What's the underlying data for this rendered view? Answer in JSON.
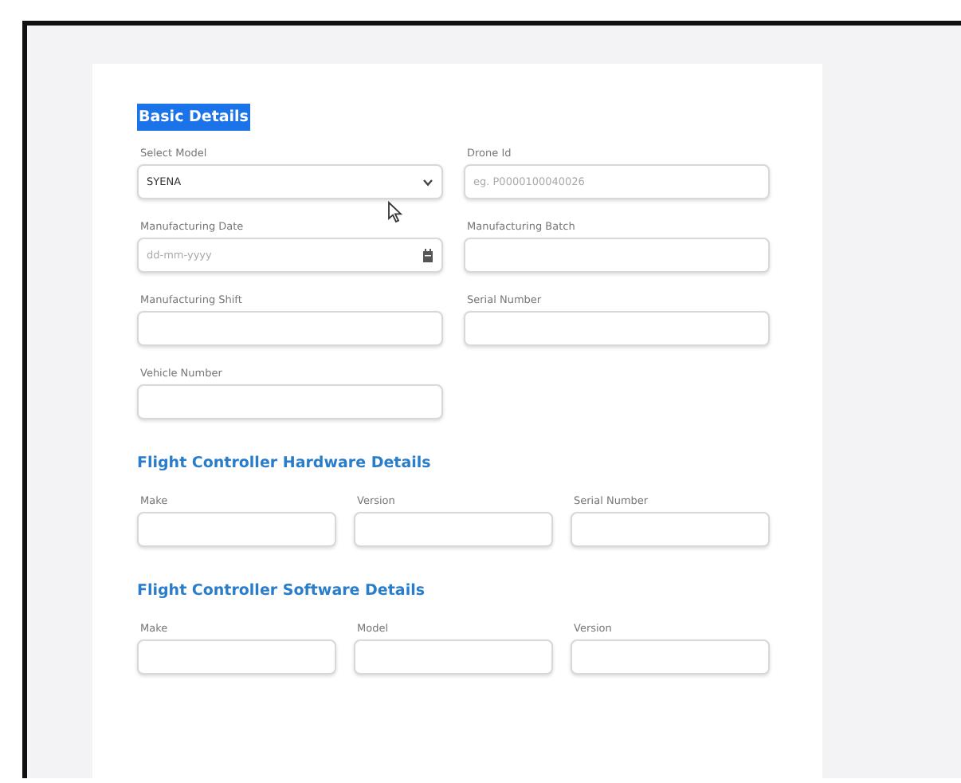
{
  "sections": [
    {
      "title": "Basic Details",
      "title_selected": true,
      "fields": [
        {
          "label": "Select Model",
          "kind": "select",
          "value": "SYENA"
        },
        {
          "label": "Drone Id",
          "kind": "text",
          "placeholder": "eg. P0000100040026"
        },
        {
          "label": "Manufacturing Date",
          "kind": "date",
          "placeholder": "dd-mm-yyyy"
        },
        {
          "label": "Manufacturing Batch",
          "kind": "text"
        },
        {
          "label": "Manufacturing Shift",
          "kind": "text"
        },
        {
          "label": "Serial Number",
          "kind": "text"
        },
        {
          "label": "Vehicle Number",
          "kind": "text"
        }
      ]
    },
    {
      "title": "Flight Controller Hardware Details",
      "title_selected": false,
      "fields": [
        {
          "label": "Make",
          "kind": "text"
        },
        {
          "label": "Version",
          "kind": "text"
        },
        {
          "label": "Serial Number",
          "kind": "text"
        }
      ]
    },
    {
      "title": "Flight Controller Software Details",
      "title_selected": false,
      "fields": [
        {
          "label": "Make",
          "kind": "text"
        },
        {
          "label": "Model",
          "kind": "text"
        },
        {
          "label": "Version",
          "kind": "text"
        }
      ]
    }
  ]
}
